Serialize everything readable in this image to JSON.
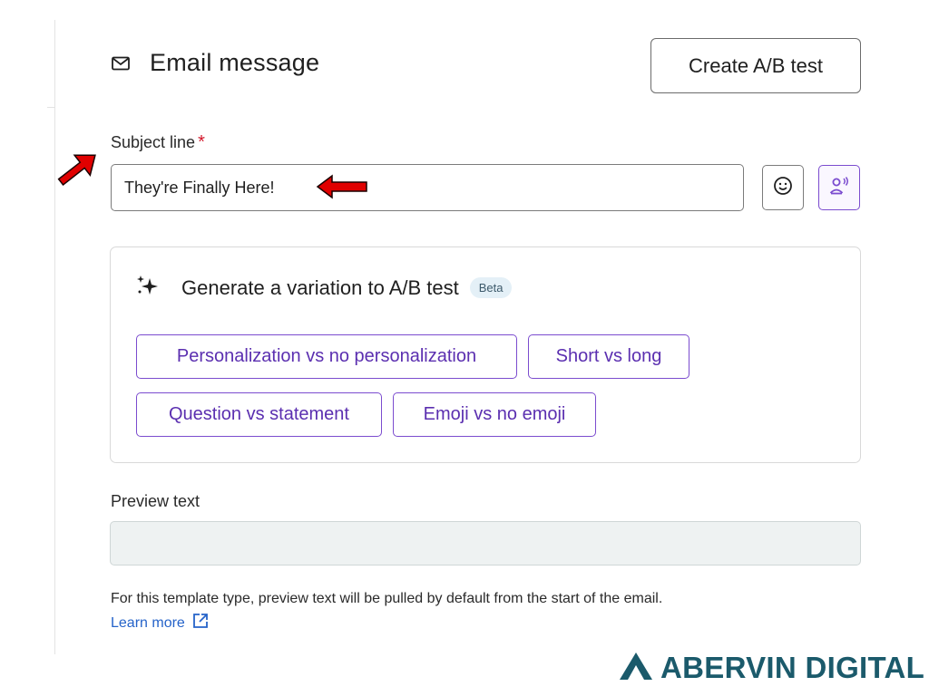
{
  "panel": {
    "title": "Email message",
    "create_ab_label": "Create A/B test"
  },
  "subject": {
    "label": "Subject line",
    "required_marker": "*",
    "value": "They're Finally Here!"
  },
  "generator": {
    "title": "Generate a variation to A/B test",
    "badge": "Beta",
    "options": [
      "Personalization vs no personalization",
      "Short vs long",
      "Question vs statement",
      "Emoji vs no emoji"
    ]
  },
  "preview": {
    "label": "Preview text",
    "value": "",
    "help": "For this template type, preview text will be pulled by default from the start of the email.",
    "learn_more": "Learn more"
  },
  "brand": {
    "name": "ABERVIN DIGITAL",
    "color": "#1b5a6b"
  },
  "colors": {
    "accent": "#7b4ccf",
    "required": "#d3172b",
    "annotation_arrow": "#e00000",
    "link": "#2563c9"
  },
  "icons": [
    "envelope-icon",
    "smiley-icon",
    "voice-person-icon",
    "sparkle-icon",
    "external-link-icon",
    "brand-logo-icon"
  ]
}
